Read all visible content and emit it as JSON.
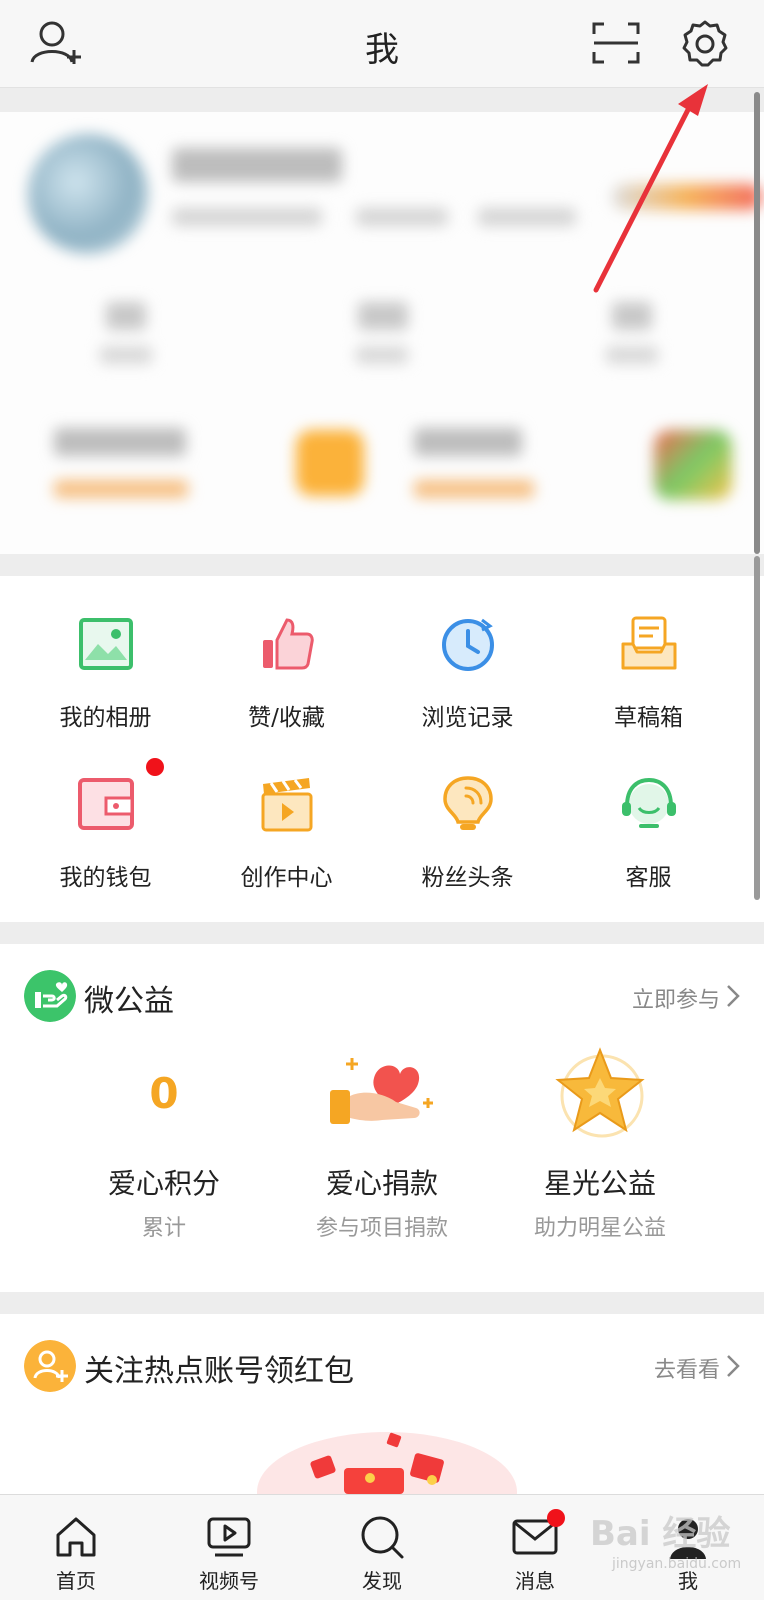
{
  "topbar": {
    "title": "我",
    "icons": [
      "add-friend-icon",
      "scan-icon",
      "gear-icon"
    ]
  },
  "grid": {
    "items": [
      {
        "label": "我的相册",
        "icon": "photo-album-icon",
        "color": "#3cbf6b"
      },
      {
        "label": "赞/收藏",
        "icon": "thumbs-up-icon",
        "color": "#ec5b6c"
      },
      {
        "label": "浏览记录",
        "icon": "history-clock-icon",
        "color": "#3b8fe6"
      },
      {
        "label": "草稿箱",
        "icon": "draft-box-icon",
        "color": "#f5a623"
      },
      {
        "label": "我的钱包",
        "icon": "wallet-icon",
        "color": "#ec5b6c",
        "badge": true
      },
      {
        "label": "创作中心",
        "icon": "clapperboard-icon",
        "color": "#f5a623"
      },
      {
        "label": "粉丝头条",
        "icon": "lightbulb-icon",
        "color": "#f5a623"
      },
      {
        "label": "客服",
        "icon": "headset-icon",
        "color": "#3cbf6b"
      }
    ]
  },
  "charity": {
    "title": "微公益",
    "link": "立即参与",
    "columns": [
      {
        "value": "0",
        "label": "爱心积分",
        "sub": "累计"
      },
      {
        "label": "爱心捐款",
        "sub": "参与项目捐款"
      },
      {
        "label": "星光公益",
        "sub": "助力明星公益"
      }
    ]
  },
  "redpacket": {
    "title": "关注热点账号领红包",
    "link": "去看看"
  },
  "bottom_nav": {
    "items": [
      {
        "label": "首页",
        "icon": "home-icon"
      },
      {
        "label": "视频号",
        "icon": "video-icon"
      },
      {
        "label": "发现",
        "icon": "search-icon"
      },
      {
        "label": "消息",
        "icon": "mail-icon",
        "badge": true
      },
      {
        "label": "我",
        "icon": "profile-icon",
        "active": true
      }
    ]
  },
  "watermark": {
    "text": "Bai 经验",
    "sub": "jingyan.baidu.com"
  },
  "colors": {
    "accent": "#f5a623",
    "badge": "#f0121a",
    "annotation_arrow": "#e8323a"
  }
}
